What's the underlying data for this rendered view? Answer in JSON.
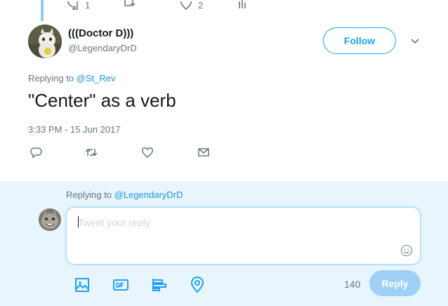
{
  "top_actions": {
    "replies": "1",
    "likes": "2"
  },
  "tweet": {
    "display_name": "(((Doctor D)))",
    "handle": "@LegendaryDrD",
    "follow_label": "Follow",
    "replying_prefix": "Replying to",
    "replying_to": "@St_Rev",
    "text": "\"Center\" as a verb",
    "timestamp": "3:33 PM - 15 Jun 2017"
  },
  "reply": {
    "replying_prefix": "Replying to",
    "replying_to": "@LegendaryDrD",
    "placeholder": "Tweet your reply",
    "char_count": "140",
    "submit_label": "Reply"
  },
  "colors": {
    "accent": "#1da1f2",
    "link": "#1b95e0",
    "muted": "#657786",
    "panel_bg": "#e8f5fd",
    "reply_disabled": "#9fd0f6"
  },
  "icons": [
    "reply-icon",
    "retweet-icon",
    "like-icon",
    "analytics-icon",
    "direct-message-icon",
    "chevron-down-icon",
    "image-icon",
    "gif-icon",
    "poll-icon",
    "location-icon",
    "emoji-icon"
  ]
}
